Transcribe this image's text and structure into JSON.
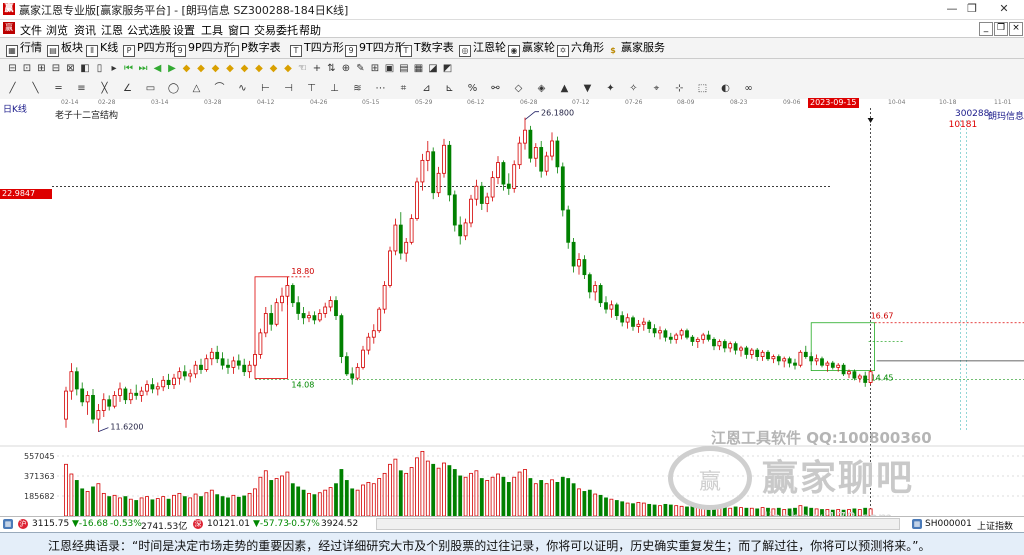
{
  "window": {
    "title": "赢家江恩专业版[赢家服务平台] - [朗玛信息 SZ300288-184日K线]",
    "app_icon": "app-logo-icon",
    "minimize": "—",
    "restore": "❐",
    "close": "✕"
  },
  "menubar": {
    "items": [
      "文件",
      "浏览",
      "资讯",
      "江恩",
      "公式选股",
      "设置",
      "工具",
      "窗口",
      "交易委托",
      "帮助"
    ],
    "mdi_min": "_",
    "mdi_restore": "❐",
    "mdi_close": "×"
  },
  "toolbar1": {
    "items": [
      {
        "label": "行情",
        "icon": "grid-icon",
        "glyph": "▦"
      },
      {
        "label": "板块",
        "icon": "sector-icon",
        "glyph": "▤"
      },
      {
        "label": "K线",
        "icon": "candle-icon",
        "glyph": "⫴"
      },
      {
        "label": "P四方形",
        "icon": "p-square-icon",
        "glyph": "P"
      },
      {
        "label": "9P四方形",
        "icon": "9p-square-icon",
        "glyph": "9"
      },
      {
        "label": "P数字表",
        "icon": "p-table-icon",
        "glyph": "P"
      },
      {
        "label": "T四方形",
        "icon": "t-square-icon",
        "glyph": "T"
      },
      {
        "label": "9T四方形",
        "icon": "9t-square-icon",
        "glyph": "9"
      },
      {
        "label": "T数字表",
        "icon": "t-table-icon",
        "glyph": "T"
      },
      {
        "label": "江恩轮",
        "icon": "gann-wheel-icon",
        "glyph": "◎"
      },
      {
        "label": "赢家轮",
        "icon": "winner-wheel-icon",
        "glyph": "◉"
      },
      {
        "label": "六角形",
        "icon": "hexagon-icon",
        "glyph": "✡"
      },
      {
        "label": "赢家服务",
        "icon": "dollar-icon",
        "glyph": "$"
      }
    ]
  },
  "toolbar2_glyphs": [
    "⊟",
    "⊡",
    "⊞",
    "⊟",
    "⊠",
    "◧",
    "▯",
    "▸",
    "⏮",
    "⏭",
    "◀",
    "▶",
    "◆",
    "◆",
    "◆",
    "◆",
    "◆",
    "◆",
    "◆",
    "◆",
    "☜",
    "+",
    "⇅",
    "⊕",
    "✎",
    "⊞",
    "▣",
    "▤",
    "▦",
    "◪",
    "◩"
  ],
  "toolbar3_glyphs": [
    "╱",
    "╲",
    "═",
    "≡",
    "╳",
    "∠",
    "▭",
    "◯",
    "△",
    "⌒",
    "∿",
    "⊢",
    "⊣",
    "⊤",
    "⊥",
    "≋",
    "⋯",
    "⌗",
    "⊿",
    "⊾",
    "%",
    "⚯",
    "◇",
    "◈",
    "▲",
    "▼",
    "✦",
    "✧",
    "⌖",
    "⊹",
    "⬚",
    "◐",
    "∞"
  ],
  "dateaxis": [
    "02-14",
    "02-28",
    "03-14",
    "03-28",
    "04-12",
    "04-26",
    "05-15",
    "05-29",
    "06-12",
    "06-28",
    "07-12",
    "07-26",
    "08-09",
    "08-23",
    "09-06",
    "2023-09-15",
    "10-04",
    "10-18",
    "11-01"
  ],
  "chart": {
    "period": "日K线",
    "structure": "老子十二宫结构",
    "code": "300288",
    "name": "朗玛信息",
    "cursor_price": "22.9847",
    "cursor_date": "2023-09-15",
    "right_mark": "10181",
    "annotations": {
      "high": "26.1800",
      "box1_top": "18.80",
      "box1_bottom": "14.08",
      "box2_top": "16.67",
      "box2_bottom": "14.45",
      "low": "11.6200"
    }
  },
  "chart_data": {
    "type": "candlestick",
    "title": "老子十二宫结构",
    "ylim": [
      11.0,
      27.0
    ],
    "up_color": "#d40000",
    "down_color": "#008000",
    "ohlc": [
      [
        12.2,
        13.7,
        11.8,
        13.5
      ],
      [
        13.5,
        14.8,
        13.1,
        14.4
      ],
      [
        14.4,
        14.6,
        13.3,
        13.6
      ],
      [
        13.6,
        13.9,
        12.8,
        13.0
      ],
      [
        13.0,
        13.5,
        12.4,
        13.3
      ],
      [
        13.3,
        13.6,
        12.0,
        12.2
      ],
      [
        12.2,
        12.9,
        11.62,
        12.6
      ],
      [
        12.6,
        13.4,
        12.3,
        13.1
      ],
      [
        13.1,
        13.3,
        12.6,
        12.8
      ],
      [
        12.8,
        13.5,
        12.7,
        13.3
      ],
      [
        13.3,
        13.9,
        13.0,
        13.6
      ],
      [
        13.6,
        13.7,
        12.9,
        13.1
      ],
      [
        13.1,
        13.6,
        12.9,
        13.4
      ],
      [
        13.4,
        13.8,
        13.1,
        13.3
      ],
      [
        13.3,
        13.7,
        13.0,
        13.5
      ],
      [
        13.5,
        14.0,
        13.3,
        13.8
      ],
      [
        13.8,
        14.1,
        13.4,
        13.6
      ],
      [
        13.6,
        13.9,
        13.3,
        13.7
      ],
      [
        13.7,
        14.2,
        13.5,
        14.0
      ],
      [
        14.0,
        14.3,
        13.6,
        13.8
      ],
      [
        13.8,
        14.3,
        13.6,
        14.1
      ],
      [
        14.1,
        14.6,
        13.8,
        14.4
      ],
      [
        14.4,
        14.7,
        14.0,
        14.2
      ],
      [
        14.2,
        14.5,
        13.9,
        14.3
      ],
      [
        14.3,
        14.9,
        14.1,
        14.7
      ],
      [
        14.7,
        15.0,
        14.3,
        14.5
      ],
      [
        14.5,
        15.2,
        14.4,
        15.0
      ],
      [
        15.0,
        15.5,
        14.7,
        15.3
      ],
      [
        15.3,
        15.6,
        14.8,
        15.0
      ],
      [
        15.0,
        15.3,
        14.5,
        14.7
      ],
      [
        14.7,
        15.0,
        14.3,
        14.6
      ],
      [
        14.6,
        15.1,
        14.3,
        14.9
      ],
      [
        14.9,
        15.2,
        14.5,
        14.7
      ],
      [
        14.7,
        15.0,
        14.2,
        14.4
      ],
      [
        14.4,
        14.9,
        14.1,
        14.7
      ],
      [
        14.7,
        15.4,
        14.6,
        15.2
      ],
      [
        15.2,
        16.4,
        15.0,
        16.2
      ],
      [
        16.2,
        17.4,
        16.0,
        17.1
      ],
      [
        17.1,
        17.5,
        16.3,
        16.6
      ],
      [
        16.6,
        17.8,
        16.5,
        17.6
      ],
      [
        17.6,
        18.3,
        17.2,
        17.9
      ],
      [
        17.9,
        18.8,
        17.5,
        18.4
      ],
      [
        18.4,
        18.5,
        17.4,
        17.6
      ],
      [
        17.6,
        17.9,
        16.8,
        17.1
      ],
      [
        17.1,
        17.4,
        16.6,
        16.9
      ],
      [
        16.9,
        17.2,
        16.7,
        17.0
      ],
      [
        17.0,
        17.2,
        16.6,
        16.8
      ],
      [
        16.8,
        17.3,
        16.7,
        17.1
      ],
      [
        17.1,
        17.6,
        16.9,
        17.4
      ],
      [
        17.4,
        17.9,
        17.2,
        17.7
      ],
      [
        17.7,
        17.9,
        16.8,
        17.0
      ],
      [
        17.0,
        17.1,
        14.8,
        15.1
      ],
      [
        15.1,
        15.3,
        14.2,
        14.3
      ],
      [
        14.3,
        14.6,
        13.8,
        14.1
      ],
      [
        14.1,
        14.8,
        14.0,
        14.6
      ],
      [
        14.6,
        15.6,
        14.5,
        15.4
      ],
      [
        15.4,
        16.2,
        15.2,
        16.0
      ],
      [
        16.0,
        16.6,
        15.7,
        16.3
      ],
      [
        16.3,
        17.4,
        16.2,
        17.3
      ],
      [
        17.3,
        18.6,
        17.1,
        18.4
      ],
      [
        18.4,
        20.2,
        18.3,
        20.0
      ],
      [
        20.0,
        21.5,
        19.8,
        21.2
      ],
      [
        21.2,
        21.8,
        19.6,
        19.9
      ],
      [
        19.9,
        20.6,
        19.5,
        20.4
      ],
      [
        20.4,
        21.7,
        20.3,
        21.5
      ],
      [
        21.5,
        23.4,
        21.4,
        23.2
      ],
      [
        23.2,
        24.5,
        22.8,
        24.2
      ],
      [
        24.2,
        25.1,
        23.7,
        24.6
      ],
      [
        24.6,
        24.8,
        22.4,
        22.7
      ],
      [
        22.7,
        23.9,
        22.5,
        23.6
      ],
      [
        23.6,
        25.2,
        23.4,
        24.9
      ],
      [
        24.9,
        25.1,
        22.3,
        22.6
      ],
      [
        22.6,
        22.8,
        20.9,
        21.2
      ],
      [
        21.2,
        21.6,
        20.3,
        20.7
      ],
      [
        20.7,
        21.5,
        20.5,
        21.3
      ],
      [
        21.3,
        22.6,
        21.1,
        22.4
      ],
      [
        22.4,
        23.3,
        22.1,
        23.0
      ],
      [
        23.0,
        23.2,
        21.9,
        22.2
      ],
      [
        22.2,
        22.7,
        21.8,
        22.5
      ],
      [
        22.5,
        23.7,
        22.3,
        23.4
      ],
      [
        23.4,
        24.4,
        23.1,
        24.1
      ],
      [
        24.1,
        24.2,
        22.8,
        23.1
      ],
      [
        23.1,
        23.6,
        22.6,
        22.9
      ],
      [
        22.9,
        24.2,
        22.7,
        24.0
      ],
      [
        24.0,
        25.3,
        23.8,
        25.0
      ],
      [
        25.0,
        26.18,
        24.7,
        25.6
      ],
      [
        25.6,
        25.8,
        24.1,
        24.3
      ],
      [
        24.3,
        25.0,
        23.9,
        24.8
      ],
      [
        24.8,
        25.1,
        23.4,
        23.7
      ],
      [
        23.7,
        24.6,
        23.5,
        24.4
      ],
      [
        24.4,
        25.5,
        24.2,
        25.1
      ],
      [
        25.1,
        25.3,
        23.6,
        23.9
      ],
      [
        23.9,
        24.1,
        21.6,
        21.9
      ],
      [
        21.9,
        22.1,
        20.1,
        20.4
      ],
      [
        20.4,
        20.6,
        19.0,
        19.3
      ],
      [
        19.3,
        19.9,
        18.9,
        19.6
      ],
      [
        19.6,
        19.8,
        18.7,
        18.9
      ],
      [
        18.9,
        19.0,
        17.8,
        18.1
      ],
      [
        18.1,
        18.6,
        17.7,
        18.4
      ],
      [
        18.4,
        18.5,
        17.4,
        17.6
      ],
      [
        17.6,
        17.9,
        17.1,
        17.3
      ],
      [
        17.3,
        17.7,
        16.9,
        17.5
      ],
      [
        17.5,
        17.6,
        16.8,
        17.0
      ],
      [
        17.0,
        17.2,
        16.5,
        16.7
      ],
      [
        16.7,
        17.1,
        16.4,
        16.9
      ],
      [
        16.9,
        17.0,
        16.3,
        16.5
      ],
      [
        16.5,
        16.8,
        16.2,
        16.6
      ],
      [
        16.6,
        16.9,
        16.3,
        16.7
      ],
      [
        16.7,
        16.8,
        16.2,
        16.4
      ],
      [
        16.4,
        16.6,
        16.0,
        16.2
      ],
      [
        16.2,
        16.5,
        15.9,
        16.3
      ],
      [
        16.3,
        16.4,
        15.8,
        16.0
      ],
      [
        16.0,
        16.2,
        15.7,
        15.9
      ],
      [
        15.9,
        16.2,
        15.7,
        16.1
      ],
      [
        16.1,
        16.4,
        15.9,
        16.3
      ],
      [
        16.3,
        16.4,
        15.9,
        16.0
      ],
      [
        16.0,
        16.1,
        15.6,
        15.8
      ],
      [
        15.8,
        16.0,
        15.5,
        15.9
      ],
      [
        15.9,
        16.2,
        15.7,
        16.1
      ],
      [
        16.1,
        16.3,
        15.8,
        15.9
      ],
      [
        15.9,
        16.0,
        15.4,
        15.6
      ],
      [
        15.6,
        15.9,
        15.4,
        15.8
      ],
      [
        15.8,
        15.9,
        15.3,
        15.5
      ],
      [
        15.5,
        15.8,
        15.3,
        15.7
      ],
      [
        15.7,
        15.8,
        15.2,
        15.4
      ],
      [
        15.4,
        15.6,
        15.1,
        15.5
      ],
      [
        15.5,
        15.6,
        15.0,
        15.2
      ],
      [
        15.2,
        15.5,
        15.0,
        15.4
      ],
      [
        15.4,
        15.5,
        14.9,
        15.1
      ],
      [
        15.1,
        15.4,
        14.9,
        15.3
      ],
      [
        15.3,
        15.4,
        14.9,
        15.0
      ],
      [
        15.0,
        15.2,
        14.8,
        15.1
      ],
      [
        15.1,
        15.2,
        14.7,
        14.9
      ],
      [
        14.9,
        15.1,
        14.6,
        15.0
      ],
      [
        15.0,
        15.1,
        14.6,
        14.8
      ],
      [
        14.8,
        15.0,
        14.5,
        14.7
      ],
      [
        14.7,
        15.4,
        14.6,
        15.3
      ],
      [
        15.3,
        15.6,
        15.0,
        15.1
      ],
      [
        15.1,
        15.3,
        14.7,
        14.9
      ],
      [
        14.9,
        15.2,
        14.7,
        15.0
      ],
      [
        15.0,
        15.1,
        14.6,
        14.7
      ],
      [
        14.7,
        14.9,
        14.4,
        14.8
      ],
      [
        14.8,
        14.9,
        14.5,
        14.6
      ],
      [
        14.6,
        14.8,
        14.4,
        14.7
      ],
      [
        14.7,
        14.8,
        14.2,
        14.3
      ],
      [
        14.3,
        14.5,
        14.1,
        14.4
      ],
      [
        14.4,
        14.5,
        14.0,
        14.1
      ],
      [
        14.1,
        14.3,
        13.9,
        14.2
      ],
      [
        14.2,
        14.4,
        13.7,
        13.9
      ],
      [
        13.9,
        14.5,
        13.8,
        14.4
      ]
    ],
    "volume_ticks": [
      "557045",
      "371363",
      "185682"
    ],
    "volume_scale_max": 650000,
    "volume_relative": [
      0.8,
      0.65,
      0.55,
      0.42,
      0.38,
      0.45,
      0.5,
      0.35,
      0.3,
      0.32,
      0.28,
      0.3,
      0.26,
      0.24,
      0.28,
      0.3,
      0.25,
      0.27,
      0.3,
      0.26,
      0.32,
      0.35,
      0.3,
      0.28,
      0.34,
      0.3,
      0.36,
      0.4,
      0.33,
      0.3,
      0.28,
      0.32,
      0.29,
      0.31,
      0.35,
      0.42,
      0.6,
      0.7,
      0.55,
      0.58,
      0.62,
      0.68,
      0.5,
      0.45,
      0.4,
      0.35,
      0.33,
      0.36,
      0.4,
      0.44,
      0.5,
      0.72,
      0.55,
      0.42,
      0.4,
      0.48,
      0.52,
      0.5,
      0.58,
      0.66,
      0.8,
      0.88,
      0.7,
      0.66,
      0.75,
      0.9,
      1.0,
      0.85,
      0.8,
      0.74,
      0.82,
      0.78,
      0.72,
      0.62,
      0.6,
      0.66,
      0.7,
      0.58,
      0.55,
      0.6,
      0.65,
      0.6,
      0.52,
      0.6,
      0.68,
      0.72,
      0.58,
      0.5,
      0.55,
      0.5,
      0.56,
      0.52,
      0.6,
      0.58,
      0.5,
      0.42,
      0.38,
      0.4,
      0.34,
      0.32,
      0.28,
      0.26,
      0.24,
      0.22,
      0.2,
      0.19,
      0.21,
      0.2,
      0.18,
      0.17,
      0.16,
      0.18,
      0.17,
      0.16,
      0.15,
      0.14,
      0.16,
      0.15,
      0.14,
      0.13,
      0.15,
      0.14,
      0.13,
      0.12,
      0.14,
      0.13,
      0.12,
      0.12,
      0.11,
      0.13,
      0.12,
      0.11,
      0.12,
      0.1,
      0.11,
      0.12,
      0.16,
      0.14,
      0.12,
      0.11,
      0.1,
      0.1,
      0.09,
      0.1,
      0.09,
      0.1,
      0.11,
      0.1,
      0.12,
      0.11
    ]
  },
  "statusbar": {
    "sh_value": "3115.75",
    "sh_change": "▼-16.68",
    "sh_pct": "-0.53%",
    "sh_amount": "2741.53亿",
    "sz_value": "10121.01",
    "sz_change": "▼-57.73",
    "sz_pct": "-0.57%",
    "sz_amount": "3924.52",
    "index_code": "SH000001",
    "index_name": "上证指数"
  },
  "watermark": {
    "line1": "江恩工具软件  QQ:100800360",
    "line2": "赢家聊吧",
    "line3": "liaoba.yj178.com",
    "logo": "赢"
  },
  "quote": "江恩经典语录：“时间是决定市场走势的重要因素，经过详细研究大市及个别股票的过往记录，你将可以证明，历史确实重复发生；而了解过往，你将可以预测将来。”。"
}
